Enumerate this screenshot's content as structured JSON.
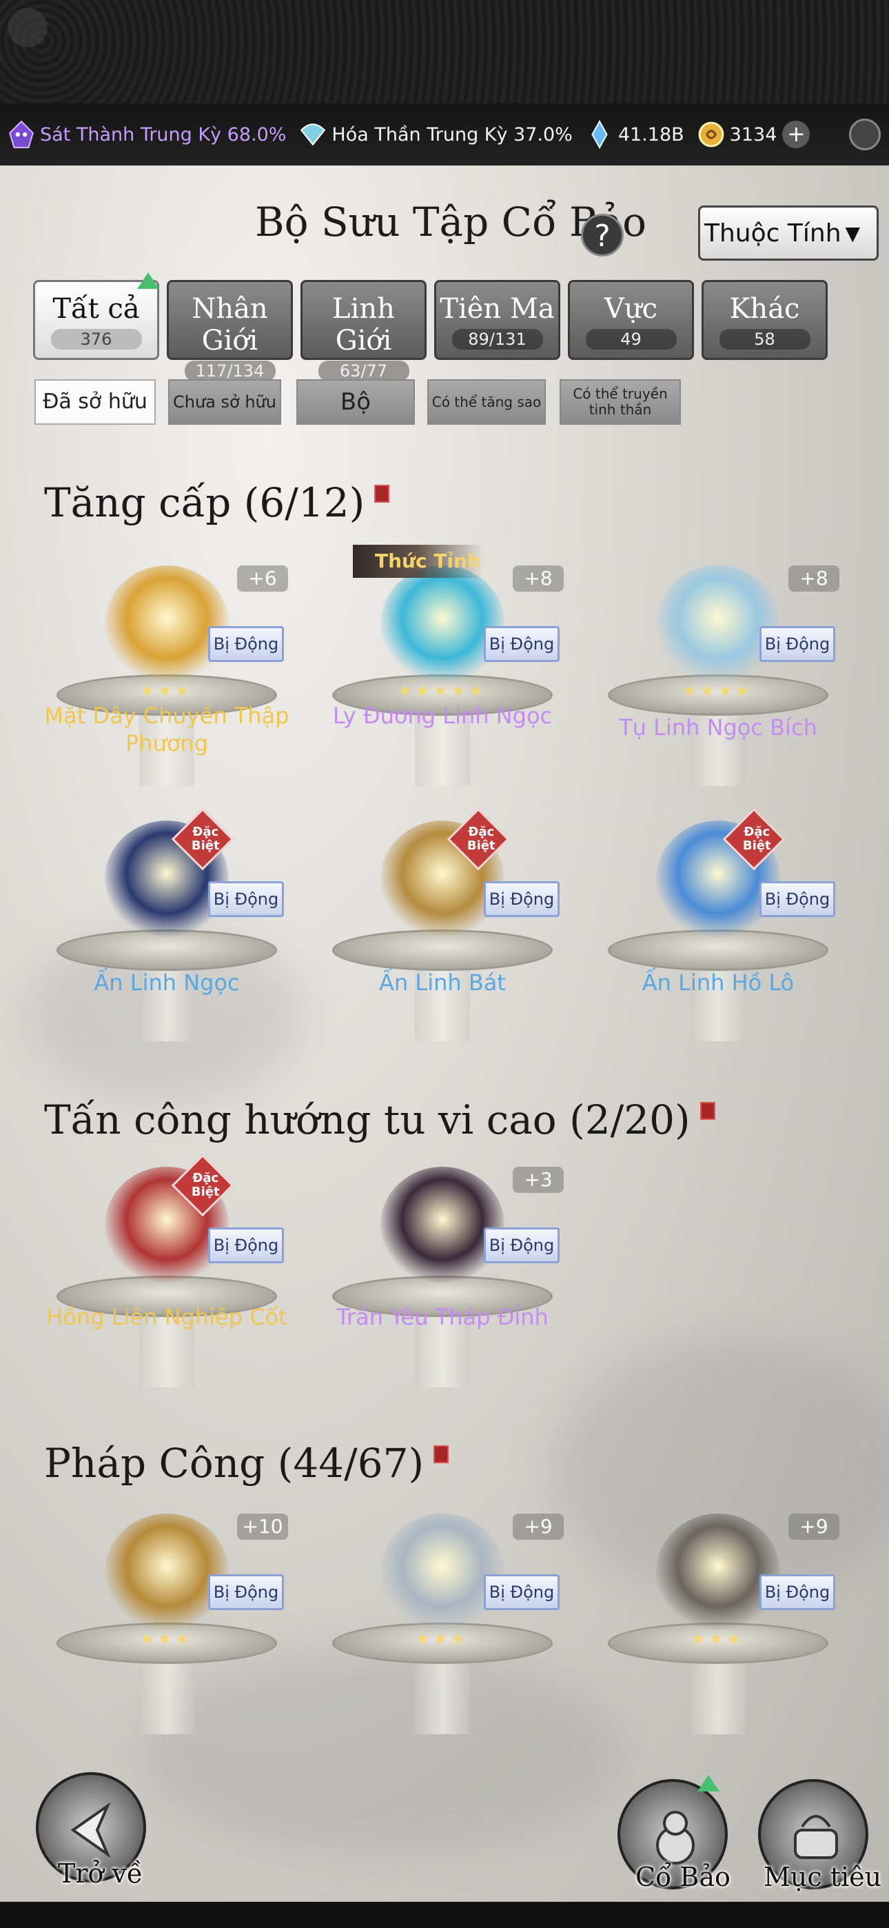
{
  "status": {
    "realm1": "Sát Thành Trung Kỳ 68.0%",
    "realm2": "Hóa Thần Trung Kỳ 37.0%",
    "gems": "41.18B",
    "coins": "3134"
  },
  "header": {
    "title": "Bộ Sưu Tập Cổ Bảo",
    "help": "?",
    "attr_dropdown": "Thuộc Tính"
  },
  "tabs": [
    {
      "label": "Tất cả",
      "count": "376"
    },
    {
      "label": "Nhân Giới",
      "count": "117/134"
    },
    {
      "label": "Linh Giới",
      "count": "63/77"
    },
    {
      "label": "Tiên Ma",
      "count": "89/131"
    },
    {
      "label": "Vực",
      "count": "49"
    },
    {
      "label": "Khác",
      "count": "58"
    }
  ],
  "filters": [
    {
      "label": "Đã sở hữu"
    },
    {
      "label": "Chưa sở hữu"
    },
    {
      "label": "Bộ"
    },
    {
      "label": "Có thể tăng sao"
    },
    {
      "label": "Có thể truyền tinh thần"
    }
  ],
  "sections": [
    {
      "title": "Tăng cấp (6/12)",
      "items": [
        {
          "name": "Mặt Dây Chuyền Thập Phương",
          "level": "+6",
          "passive": "Bị Động",
          "stars": "★★★",
          "color": "#f0c64e",
          "art": "#d9a236"
        },
        {
          "name": "Ly Đương Linh Ngọc",
          "level": "+8",
          "passive": "Bị Động",
          "stars": "★★★★★",
          "color": "#c58cf0",
          "art": "#3db8d8",
          "awaken": "Thức Tỉnh"
        },
        {
          "name": "Tụ Linh Ngọc Bích",
          "level": "+8",
          "passive": "Bị Động",
          "stars": "★★★★",
          "color": "#c58cf0",
          "art": "#9ac8e0"
        },
        {
          "name": "Ấn Linh Ngọc",
          "passive": "Bị Động",
          "color": "#5aa8e0",
          "art": "#2a3a70",
          "special": "Đặc Biệt"
        },
        {
          "name": "Ấn Linh Bát",
          "passive": "Bị Động",
          "color": "#5aa8e0",
          "art": "#b58b3e",
          "special": "Đặc Biệt"
        },
        {
          "name": "Ấn Linh Hồ Lô",
          "passive": "Bị Động",
          "color": "#5aa8e0",
          "art": "#4a8bd6",
          "special": "Đặc Biệt"
        }
      ]
    },
    {
      "title": "Tấn công hướng tu vi cao (2/20)",
      "items": [
        {
          "name": "Hồng Liên Nghiệp Cốt",
          "passive": "Bị Động",
          "color": "#f0c64e",
          "art": "#b03535",
          "special": "Đặc Biệt"
        },
        {
          "name": "Trấn Yêu Tháp Đỉnh",
          "level": "+3",
          "passive": "Bị Động",
          "color": "#c58cf0",
          "art": "#3a2a3a"
        }
      ]
    },
    {
      "title": "Pháp Công (44/67)",
      "items": [
        {
          "name": "",
          "level": "+10",
          "passive": "Bị Động",
          "stars": "★★★",
          "color": "#f0c64e",
          "art": "#b68a3a"
        },
        {
          "name": "",
          "level": "+9",
          "passive": "Bị Động",
          "stars": "★★★",
          "color": "#f0c64e",
          "art": "#a9b6c2"
        },
        {
          "name": "",
          "level": "+9",
          "passive": "Bị Động",
          "stars": "★★★",
          "color": "#f0c64e",
          "art": "#6b6560"
        }
      ]
    }
  ],
  "bottom": {
    "back": "Trở về",
    "treasure": "Cổ Bảo",
    "tips": "Mục tiêu"
  }
}
